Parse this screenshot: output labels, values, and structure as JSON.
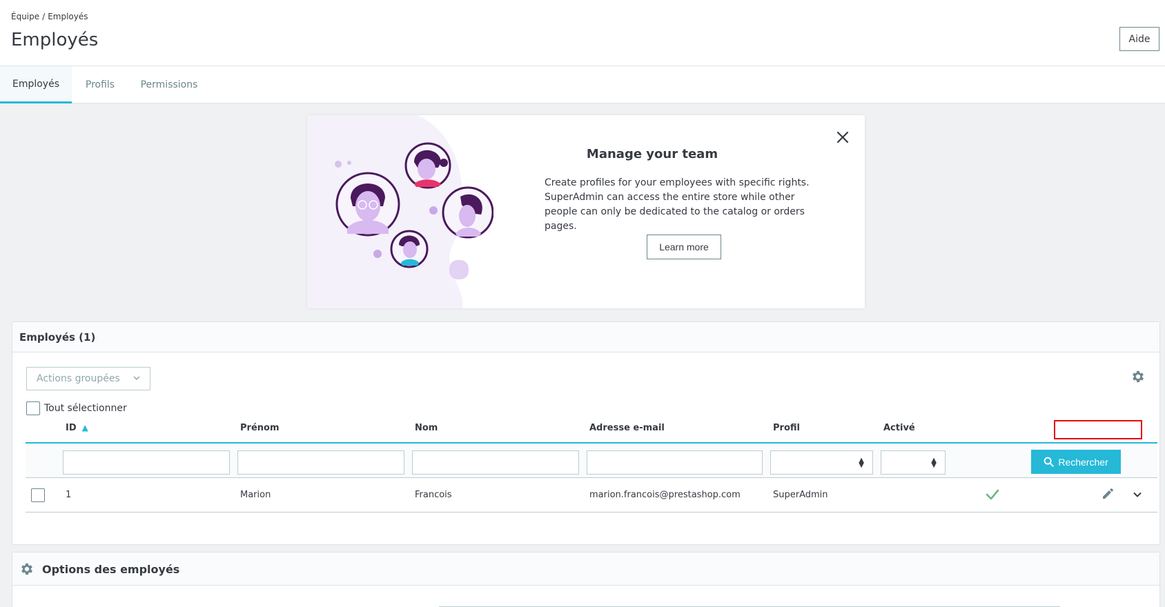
{
  "breadcrumb": {
    "parent": "Équipe",
    "separator": "/",
    "current": "Employés"
  },
  "page": {
    "title": "Employés",
    "help_label": "Aide"
  },
  "tabs": [
    {
      "label": "Employés",
      "active": true
    },
    {
      "label": "Profils",
      "active": false
    },
    {
      "label": "Permissions",
      "active": false
    }
  ],
  "banner": {
    "title": "Manage your team",
    "text": "Create profiles for your employees with specific rights. SuperAdmin can access the entire store while other people can only be dedicated to the catalog or orders pages.",
    "button": "Learn more",
    "close_icon": "close-icon"
  },
  "employees_card": {
    "title": "Employés (1)",
    "bulk_actions": "Actions groupées",
    "select_all": "Tout sélectionner",
    "columns": [
      "ID",
      "Prénom",
      "Nom",
      "Adresse e-mail",
      "Profil",
      "Activé"
    ],
    "sort_column": "ID",
    "search_button": "Rechercher",
    "rows": [
      {
        "id": "1",
        "first_name": "Marion",
        "last_name": "Francois",
        "email": "marion.francois@prestashop.com",
        "profile": "SuperAdmin",
        "active": true
      }
    ]
  },
  "options_card": {
    "title": "Options des employés"
  },
  "colors": {
    "accent": "#25b9d7",
    "success": "#70b580",
    "text": "#363a41",
    "muted": "#6c868e",
    "highlight": "#e30b0b"
  }
}
